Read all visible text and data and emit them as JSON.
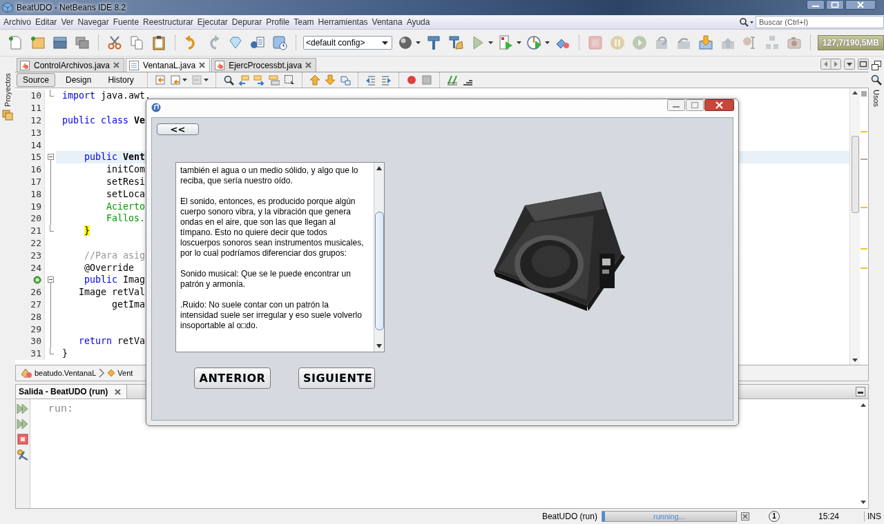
{
  "window": {
    "title": "BeatUDO - NetBeans IDE 8.2"
  },
  "menu": [
    "Archivo",
    "Editar",
    "Ver",
    "Navegar",
    "Fuente",
    "Reestructurar",
    "Ejecutar",
    "Depurar",
    "Profile",
    "Team",
    "Herramientas",
    "Ventana",
    "Ayuda"
  ],
  "search": {
    "placeholder": "Buscar (Ctrl+I)"
  },
  "toolbar": {
    "config": "<default config>",
    "memory": "127,7/190,5MB"
  },
  "left_panel": {
    "label": "Proyectos"
  },
  "right_panel": {
    "label": "Usos"
  },
  "editor_tabs": [
    {
      "label": "ControlArchivos.java",
      "selected": false
    },
    {
      "label": "VentanaL.java",
      "selected": true
    },
    {
      "label": "EjercProcessbt.java",
      "selected": false
    }
  ],
  "editor_views": [
    {
      "label": "Source",
      "selected": true
    },
    {
      "label": "Design",
      "selected": false
    },
    {
      "label": "History",
      "selected": false
    }
  ],
  "code_lines": [
    {
      "number": "10",
      "kind": "fold-end",
      "segments": [
        {
          "kind": "keyword",
          "text": "import"
        },
        {
          "kind": "plain",
          "text": " java.awt."
        }
      ]
    },
    {
      "number": "11"
    },
    {
      "number": "12",
      "segments": [
        {
          "kind": "keyword",
          "text": "public class"
        },
        {
          "kind": "bold",
          "text": " Ve"
        }
      ]
    },
    {
      "number": "13"
    },
    {
      "number": "14"
    },
    {
      "number": "15",
      "kind": "fold-start",
      "current": true,
      "segments": [
        {
          "kind": "keyword",
          "text": "    public"
        },
        {
          "kind": "bold",
          "text": " Vent"
        }
      ]
    },
    {
      "number": "16",
      "kind": "fold-body",
      "segments": [
        {
          "kind": "plain",
          "text": "        initCom"
        }
      ]
    },
    {
      "number": "17",
      "kind": "fold-body",
      "segments": [
        {
          "kind": "plain",
          "text": "        setResi"
        }
      ]
    },
    {
      "number": "18",
      "kind": "fold-body",
      "segments": [
        {
          "kind": "plain",
          "text": "        setLoca"
        }
      ]
    },
    {
      "number": "19",
      "kind": "fold-body",
      "segments": [
        {
          "kind": "field",
          "text": "        Acierto"
        }
      ]
    },
    {
      "number": "20",
      "kind": "fold-body",
      "segments": [
        {
          "kind": "field",
          "text": "        Fallos."
        }
      ]
    },
    {
      "number": "21",
      "kind": "fold-end",
      "segments": [
        {
          "kind": "match",
          "text": "    }"
        }
      ]
    },
    {
      "number": "22"
    },
    {
      "number": "23",
      "segments": [
        {
          "kind": "comment",
          "text": "    //Para asig"
        }
      ]
    },
    {
      "number": "24",
      "segments": [
        {
          "kind": "plain",
          "text": "    @Override"
        }
      ]
    },
    {
      "override_marker": true,
      "kind": "fold-start",
      "segments": [
        {
          "kind": "keyword",
          "text": "    public"
        },
        {
          "kind": "plain",
          "text": " Imag"
        }
      ]
    },
    {
      "number": "26",
      "kind": "fold-body",
      "segments": [
        {
          "kind": "plain",
          "text": "   Image retVal"
        }
      ]
    },
    {
      "number": "27",
      "kind": "fold-body",
      "segments": [
        {
          "kind": "plain",
          "text": "         getIma"
        }
      ]
    },
    {
      "number": "28",
      "kind": "fold-body"
    },
    {
      "number": "29",
      "kind": "fold-body"
    },
    {
      "number": "30",
      "kind": "fold-body",
      "segments": [
        {
          "kind": "keyword",
          "text": "   return"
        },
        {
          "kind": "plain",
          "text": " retVa"
        }
      ]
    },
    {
      "number": "31",
      "kind": "fold-end",
      "segments": [
        {
          "kind": "plain",
          "text": "}"
        }
      ]
    }
  ],
  "breadcrumb": [
    "beatudo.VentanaL",
    "Vent"
  ],
  "output": {
    "tab": "Salida - BeatUDO (run)",
    "lines": [
      "run:"
    ]
  },
  "dialog": {
    "back_button": "<<",
    "paragraphs": [
      "también el agua o un medio sólido, y algo que lo reciba, que sería nuestro oído.",
      "El sonido, entonces, es producido porque algún cuerpo sonoro vibra, y la vibración que genera ondas en el aire, que son las que llegan al tímpano. Esto no quiere decir que todos loscuerpos sonoros sean instrumentos musicales, por lo cual podríamos diferenciar dos grupos:",
      "Sonido musical: Que se le puede encontrar un patrón y armonía.",
      ".Ruido: No suele contar con un patrón  la intensidad suele ser irregular y eso suele volverlo insoportable al o□do."
    ],
    "buttons": [
      "ANTERIOR",
      "SIGUIENTE"
    ]
  },
  "status_bar": {
    "task": "BeatUDO (run)",
    "progress": "running...",
    "level": 0.02,
    "notifications": "1",
    "time": "15:24",
    "mode": "INS"
  }
}
